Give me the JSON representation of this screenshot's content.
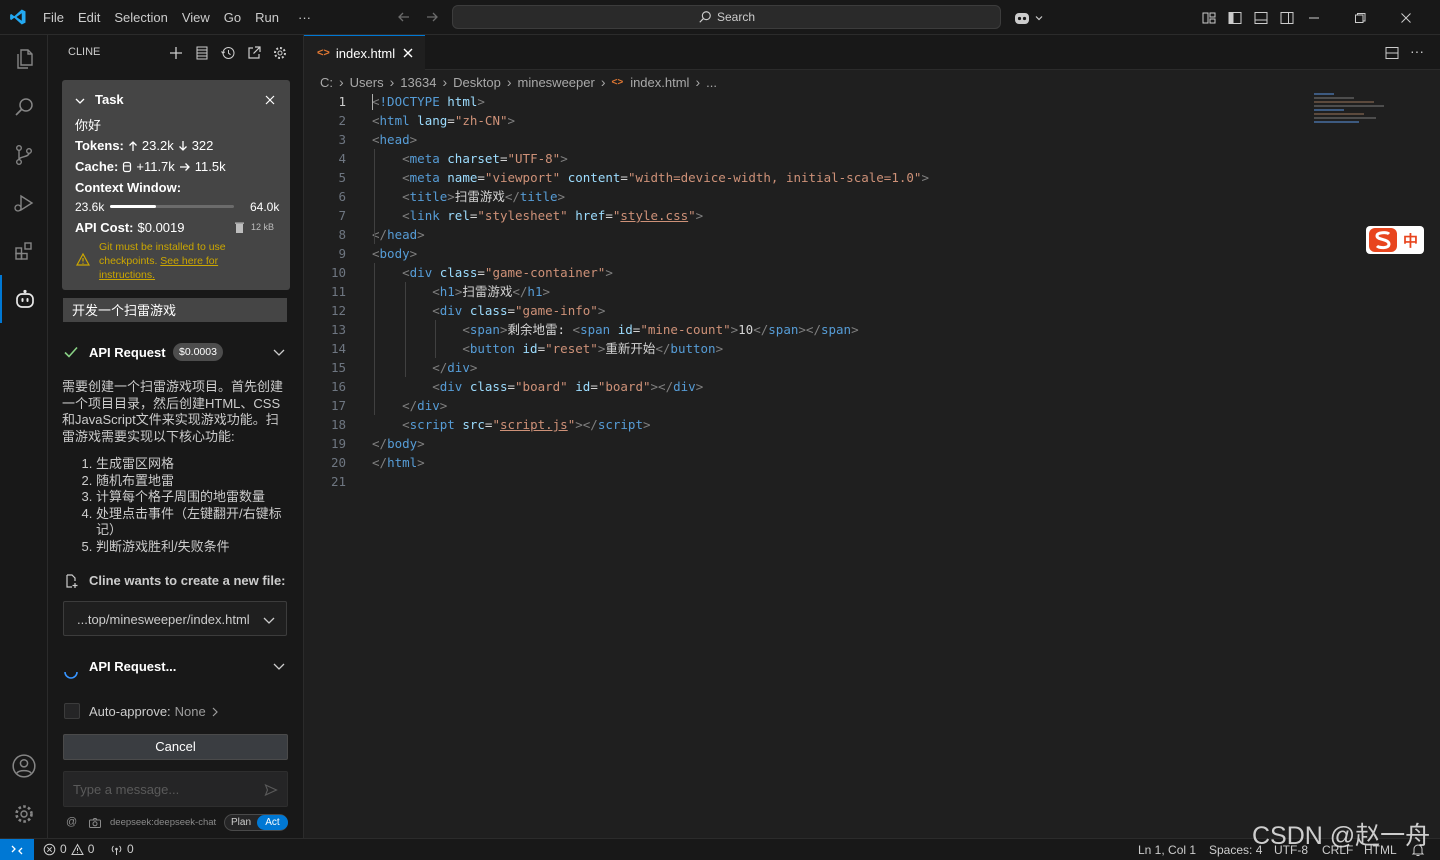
{
  "menu": {
    "file": "File",
    "edit": "Edit",
    "selection": "Selection",
    "view": "View",
    "go": "Go",
    "run": "Run",
    "more": "···"
  },
  "search": {
    "label": "Search"
  },
  "sidebar": {
    "title": "CLINE",
    "task": {
      "header": "Task",
      "text": "你好",
      "tokens_label": "Tokens:",
      "tokens_up": "23.2k",
      "tokens_down": "322",
      "cache_label": "Cache:",
      "cache_write": "+11.7k",
      "cache_read": "11.5k",
      "context_label": "Context Window:",
      "context_used": "23.6k",
      "context_max": "64.0k",
      "context_fraction": 0.37,
      "cost_label": "API Cost:",
      "cost_value": "$0.0019",
      "size": "12 kB",
      "warning_text": "Git must be installed to use checkpoints.",
      "warning_link": "See here for instructions."
    },
    "user_message": "开发一个扫雷游戏",
    "api_request": {
      "label": "API Request",
      "cost": "$0.0003"
    },
    "response_intro": "需要创建一个扫雷游戏项目。首先创建一个项目目录，然后创建HTML、CSS和JavaScript文件来实现游戏功能。扫雷游戏需要实现以下核心功能:",
    "response_list": [
      "生成雷区网格",
      "随机布置地雷",
      "计算每个格子周围的地雷数量",
      "处理点击事件（左键翻开/右键标记）",
      "判断游戏胜利/失败条件"
    ],
    "new_file_label": "Cline wants to create a new file:",
    "new_file_path": "...top/minesweeper/index.html",
    "api_request_pending": "API Request...",
    "auto_approve_label": "Auto-approve:",
    "auto_approve_value": "None",
    "cancel_label": "Cancel",
    "message_placeholder": "Type a message...",
    "model": "deepseek:deepseek-chat",
    "mode_plan": "Plan",
    "mode_act": "Act"
  },
  "editor": {
    "tab": "index.html",
    "breadcrumb": [
      "C:",
      "Users",
      "13634",
      "Desktop",
      "minesweeper",
      "index.html",
      "..."
    ],
    "line_numbers": [
      "1",
      "2",
      "3",
      "4",
      "5",
      "6",
      "7",
      "8",
      "9",
      "10",
      "11",
      "12",
      "13",
      "14",
      "15",
      "16",
      "17",
      "18",
      "19",
      "20",
      "21"
    ],
    "code": [
      [
        [
          "br",
          "<"
        ],
        [
          "tg",
          "!DOCTYPE "
        ],
        [
          "at",
          "html"
        ],
        [
          "br",
          ">"
        ]
      ],
      [
        [
          "br",
          "<"
        ],
        [
          "tg",
          "html "
        ],
        [
          "at",
          "lang"
        ],
        [
          "tx",
          "="
        ],
        [
          "st",
          "\"zh-CN\""
        ],
        [
          "br",
          ">"
        ]
      ],
      [
        [
          "br",
          "<"
        ],
        [
          "tg",
          "head"
        ],
        [
          "br",
          ">"
        ]
      ],
      [
        [
          "tx",
          "    "
        ],
        [
          "br",
          "<"
        ],
        [
          "tg",
          "meta "
        ],
        [
          "at",
          "charset"
        ],
        [
          "tx",
          "="
        ],
        [
          "st",
          "\"UTF-8\""
        ],
        [
          "br",
          ">"
        ]
      ],
      [
        [
          "tx",
          "    "
        ],
        [
          "br",
          "<"
        ],
        [
          "tg",
          "meta "
        ],
        [
          "at",
          "name"
        ],
        [
          "tx",
          "="
        ],
        [
          "st",
          "\"viewport\" "
        ],
        [
          "at",
          "content"
        ],
        [
          "tx",
          "="
        ],
        [
          "st",
          "\"width=device-width, initial-scale=1.0\""
        ],
        [
          "br",
          ">"
        ]
      ],
      [
        [
          "tx",
          "    "
        ],
        [
          "br",
          "<"
        ],
        [
          "tg",
          "title"
        ],
        [
          "br",
          ">"
        ],
        [
          "tx",
          "扫雷游戏"
        ],
        [
          "br",
          "</"
        ],
        [
          "tg",
          "title"
        ],
        [
          "br",
          ">"
        ]
      ],
      [
        [
          "tx",
          "    "
        ],
        [
          "br",
          "<"
        ],
        [
          "tg",
          "link "
        ],
        [
          "at",
          "rel"
        ],
        [
          "tx",
          "="
        ],
        [
          "st",
          "\"stylesheet\" "
        ],
        [
          "at",
          "href"
        ],
        [
          "tx",
          "="
        ],
        [
          "st",
          "\""
        ],
        [
          "stu",
          "style.css"
        ],
        [
          "st",
          "\""
        ],
        [
          "br",
          ">"
        ]
      ],
      [
        [
          "br",
          "</"
        ],
        [
          "tg",
          "head"
        ],
        [
          "br",
          ">"
        ]
      ],
      [
        [
          "br",
          "<"
        ],
        [
          "tg",
          "body"
        ],
        [
          "br",
          ">"
        ]
      ],
      [
        [
          "tx",
          "    "
        ],
        [
          "br",
          "<"
        ],
        [
          "tg",
          "div "
        ],
        [
          "at",
          "class"
        ],
        [
          "tx",
          "="
        ],
        [
          "st",
          "\"game-container\""
        ],
        [
          "br",
          ">"
        ]
      ],
      [
        [
          "tx",
          "        "
        ],
        [
          "br",
          "<"
        ],
        [
          "tg",
          "h1"
        ],
        [
          "br",
          ">"
        ],
        [
          "tx",
          "扫雷游戏"
        ],
        [
          "br",
          "</"
        ],
        [
          "tg",
          "h1"
        ],
        [
          "br",
          ">"
        ]
      ],
      [
        [
          "tx",
          "        "
        ],
        [
          "br",
          "<"
        ],
        [
          "tg",
          "div "
        ],
        [
          "at",
          "class"
        ],
        [
          "tx",
          "="
        ],
        [
          "st",
          "\"game-info\""
        ],
        [
          "br",
          ">"
        ]
      ],
      [
        [
          "tx",
          "            "
        ],
        [
          "br",
          "<"
        ],
        [
          "tg",
          "span"
        ],
        [
          "br",
          ">"
        ],
        [
          "tx",
          "剩余地雷: "
        ],
        [
          "br",
          "<"
        ],
        [
          "tg",
          "span "
        ],
        [
          "at",
          "id"
        ],
        [
          "tx",
          "="
        ],
        [
          "st",
          "\"mine-count\""
        ],
        [
          "br",
          ">"
        ],
        [
          "tx",
          "10"
        ],
        [
          "br",
          "</"
        ],
        [
          "tg",
          "span"
        ],
        [
          "br",
          "></"
        ],
        [
          "tg",
          "span"
        ],
        [
          "br",
          ">"
        ]
      ],
      [
        [
          "tx",
          "            "
        ],
        [
          "br",
          "<"
        ],
        [
          "tg",
          "button "
        ],
        [
          "at",
          "id"
        ],
        [
          "tx",
          "="
        ],
        [
          "st",
          "\"reset\""
        ],
        [
          "br",
          ">"
        ],
        [
          "tx",
          "重新开始"
        ],
        [
          "br",
          "</"
        ],
        [
          "tg",
          "button"
        ],
        [
          "br",
          ">"
        ]
      ],
      [
        [
          "tx",
          "        "
        ],
        [
          "br",
          "</"
        ],
        [
          "tg",
          "div"
        ],
        [
          "br",
          ">"
        ]
      ],
      [
        [
          "tx",
          "        "
        ],
        [
          "br",
          "<"
        ],
        [
          "tg",
          "div "
        ],
        [
          "at",
          "class"
        ],
        [
          "tx",
          "="
        ],
        [
          "st",
          "\"board\" "
        ],
        [
          "at",
          "id"
        ],
        [
          "tx",
          "="
        ],
        [
          "st",
          "\"board\""
        ],
        [
          "br",
          "></"
        ],
        [
          "tg",
          "div"
        ],
        [
          "br",
          ">"
        ]
      ],
      [
        [
          "tx",
          "    "
        ],
        [
          "br",
          "</"
        ],
        [
          "tg",
          "div"
        ],
        [
          "br",
          ">"
        ]
      ],
      [
        [
          "tx",
          "    "
        ],
        [
          "br",
          "<"
        ],
        [
          "tg",
          "script "
        ],
        [
          "at",
          "src"
        ],
        [
          "tx",
          "="
        ],
        [
          "st",
          "\""
        ],
        [
          "stu",
          "script.js"
        ],
        [
          "st",
          "\""
        ],
        [
          "br",
          "></"
        ],
        [
          "tg",
          "script"
        ],
        [
          "br",
          ">"
        ]
      ],
      [
        [
          "br",
          "</"
        ],
        [
          "tg",
          "body"
        ],
        [
          "br",
          ">"
        ]
      ],
      [
        [
          "br",
          "</"
        ],
        [
          "tg",
          "html"
        ],
        [
          "br",
          ">"
        ]
      ],
      []
    ]
  },
  "ime": {
    "label": "中"
  },
  "status": {
    "errors": "0",
    "warnings": "0",
    "ports": "0",
    "position": "Ln 1, Col 1",
    "spaces": "Spaces: 4",
    "encoding": "UTF-8",
    "eol": "CRLF",
    "language": "HTML",
    "watermark": "CSDN @赵一舟"
  },
  "colors": {
    "accent": "#0078d4",
    "check": "#89d185",
    "warning": "#cca700",
    "link": "#3794ff"
  }
}
